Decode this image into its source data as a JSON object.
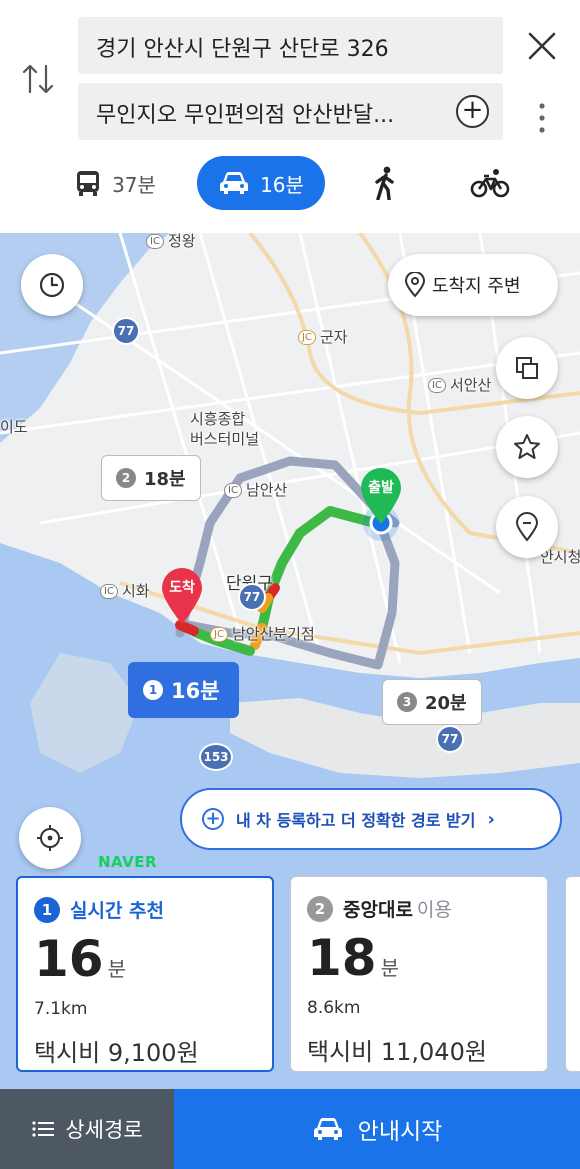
{
  "search": {
    "origin": "경기 안산시 단원구 산단로 326",
    "destination": "무인지오 무인편의점 안산반달..."
  },
  "modes": [
    {
      "id": "bus",
      "icon": "bus-icon",
      "label": "37분"
    },
    {
      "id": "car",
      "icon": "car-icon",
      "label": "16분",
      "selected": true
    },
    {
      "id": "walk",
      "icon": "walk-icon",
      "label": ""
    },
    {
      "id": "bike",
      "icon": "bike-icon",
      "label": ""
    }
  ],
  "map": {
    "nearby_button": "도착지 주변",
    "labels": {
      "jeongwang": "정왕",
      "gunja": "군자",
      "seoansan": "서안산",
      "terminal_line1": "시흥종합",
      "terminal_line2": "버스터미널",
      "namansan": "남안산",
      "sihwa": "시화",
      "danwongu": "단원구",
      "namansan_jc": "남안산분기점",
      "ido": "이도",
      "ansan_right": "안시청"
    },
    "shields": {
      "r77a": "77",
      "r77b": "77",
      "r153": "153",
      "r77c": "77"
    },
    "badges": {
      "ic": "IC",
      "jc": "JC"
    },
    "markers": {
      "start": "출발",
      "end": "도착"
    },
    "callouts": [
      {
        "num": "1",
        "time": "16분"
      },
      {
        "num": "2",
        "time": "18분"
      },
      {
        "num": "3",
        "time": "20분"
      }
    ],
    "register_banner": "내 차 등록하고 더 정확한 경로 받기",
    "brand": "NAVER"
  },
  "routes": [
    {
      "num": "1",
      "title": "실시간 추천",
      "subtitle": "",
      "time": "16",
      "unit": "분",
      "distance": "7.1km",
      "fare": "택시비 9,100원"
    },
    {
      "num": "2",
      "title": "중앙대로",
      "subtitle": "이용",
      "time": "18",
      "unit": "분",
      "distance": "8.6km",
      "fare": "택시비 11,040원"
    }
  ],
  "bottom": {
    "detail_label": "상세경로",
    "start_label": "안내시작"
  },
  "colors": {
    "accent": "#1a73e8",
    "selected_card": "#1a64d6",
    "naver_green": "#19ce60",
    "start_marker": "#1fb955",
    "end_marker": "#e8334a"
  }
}
